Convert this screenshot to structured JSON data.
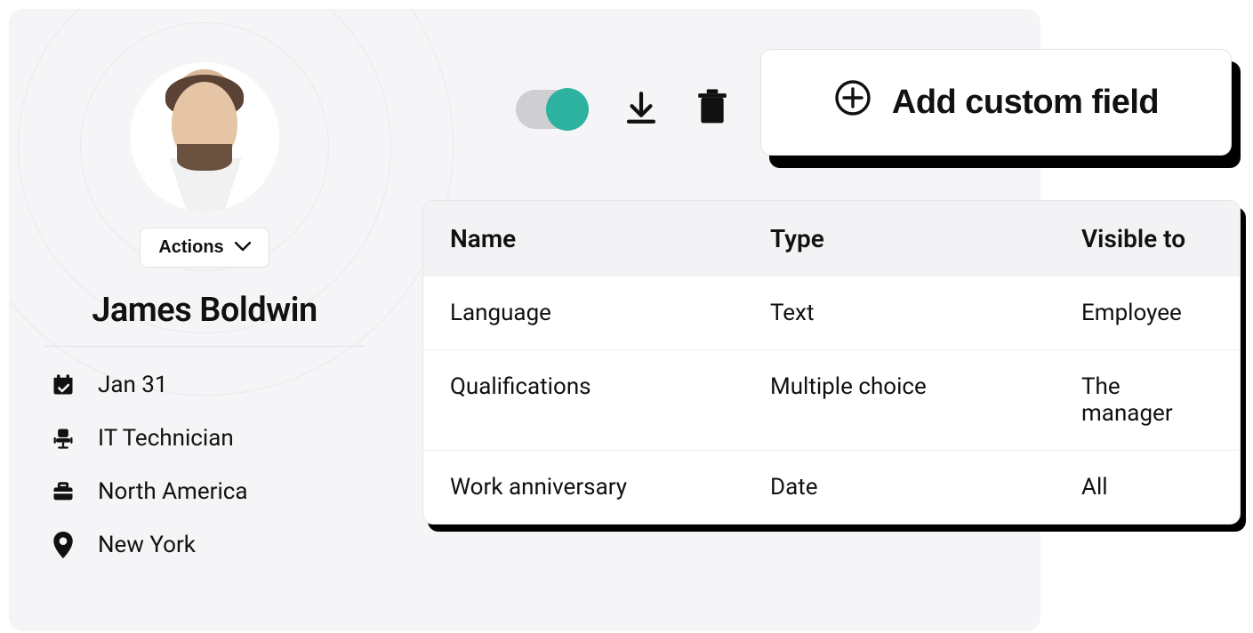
{
  "profile": {
    "actions_label": "Actions",
    "name": "James Boldwin",
    "info": {
      "date": "Jan 31",
      "role": "IT Technician",
      "region": "North America",
      "city": "New York"
    }
  },
  "toolbar": {
    "toggle_on": true
  },
  "add_field_button": "Add custom field",
  "table": {
    "headers": {
      "name": "Name",
      "type": "Type",
      "visible": "Visible to"
    },
    "rows": [
      {
        "name": "Language",
        "type": "Text",
        "visible": "Employee"
      },
      {
        "name": "Qualifications",
        "type": "Multiple choice",
        "visible": "The manager"
      },
      {
        "name": "Work anniversary",
        "type": "Date",
        "visible": "All"
      }
    ]
  }
}
